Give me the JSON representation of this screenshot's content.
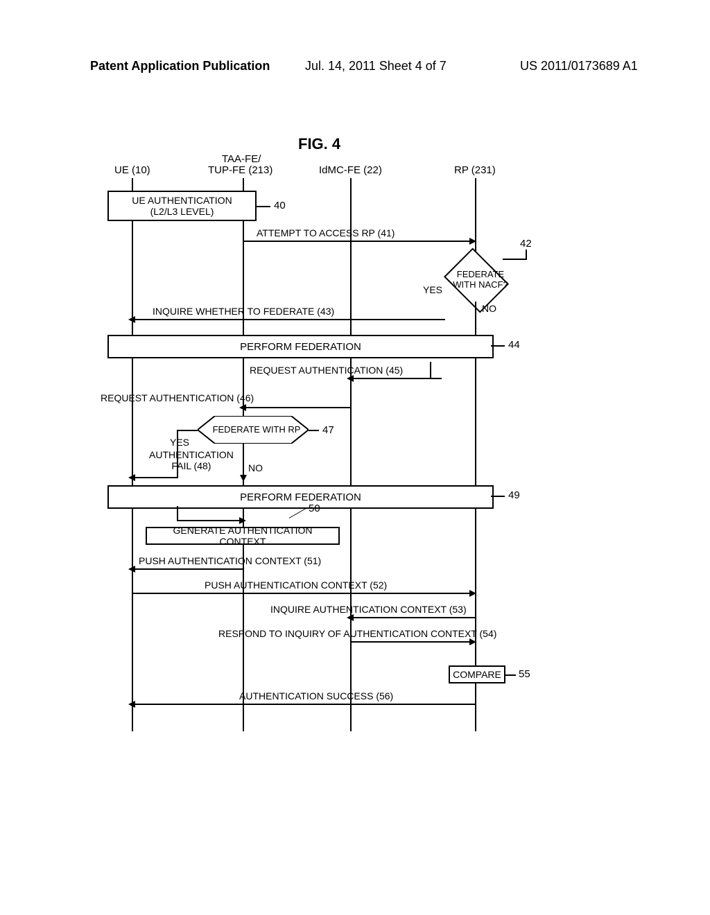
{
  "header": {
    "left": "Patent Application Publication",
    "center": "Jul. 14, 2011  Sheet 4 of 7",
    "right": "US 2011/0173689 A1"
  },
  "figure_title": "FIG.   4",
  "lanes": {
    "ue": "UE (10)",
    "taa_line1": "TAA-FE/",
    "taa_line2": "TUP-FE (213)",
    "idmc": "IdMC-FE (22)",
    "rp": "RP (231)"
  },
  "boxes": {
    "ue_auth_line1": "UE AUTHENTICATION",
    "ue_auth_line2": "(L2/L3 LEVEL)",
    "perform_fed_1": "PERFORM FEDERATION",
    "perform_fed_2": "PERFORM FEDERATION",
    "gen_auth_ctx": "GENERATE AUTHENTICATION CONTEXT",
    "compare": "COMPARE"
  },
  "diamonds": {
    "fed_nacf_line1": "FEDERATE",
    "fed_nacf_line2": "WITH NACF?",
    "fed_rp": "FEDERATE WITH RP"
  },
  "messages": {
    "m41": "ATTEMPT TO ACCESS RP (41)",
    "m43": "INQUIRE WHETHER TO FEDERATE  (43)",
    "m45": "REQUEST AUTHENTICATION (45)",
    "m46": "REQUEST AUTHENTICATION (46)",
    "m48_line1": "AUTHENTICATION",
    "m48_line2": "FAIL (48)",
    "m51": "PUSH AUTHENTICATION CONTEXT (51)",
    "m52": "PUSH AUTHENTICATION CONTEXT (52)",
    "m53": "INQUIRE AUTHENTICATION CONTEXT (53)",
    "m54": "RESPOND TO INQUIRY OF AUTHENTICATION CONTEXT (54)",
    "m56": "AUTHENTICATION SUCCESS (56)"
  },
  "labels": {
    "yes": "YES",
    "no": "NO"
  },
  "refs": {
    "r40": "40",
    "r42": "42",
    "r44": "44",
    "r47": "47",
    "r49": "49",
    "r50": "50",
    "r55": "55"
  },
  "chart_data": {
    "type": "sequence-diagram",
    "title": "FIG. 4",
    "participants": [
      {
        "id": "UE",
        "label": "UE (10)"
      },
      {
        "id": "TAA",
        "label": "TAA-FE/TUP-FE (213)"
      },
      {
        "id": "IdMC",
        "label": "IdMC-FE (22)"
      },
      {
        "id": "RP",
        "label": "RP (231)"
      }
    ],
    "steps": [
      {
        "ref": 40,
        "type": "process",
        "span": [
          "UE",
          "TAA"
        ],
        "text": "UE AUTHENTICATION (L2/L3 LEVEL)"
      },
      {
        "ref": 41,
        "type": "message",
        "from": "TAA",
        "to": "RP",
        "text": "ATTEMPT TO ACCESS RP"
      },
      {
        "ref": 42,
        "type": "decision",
        "at": "RP",
        "text": "FEDERATE WITH NACF?",
        "yes_to": 43,
        "no_to": 45
      },
      {
        "ref": 43,
        "type": "message",
        "from": "RP",
        "to": "UE",
        "text": "INQUIRE WHETHER TO FEDERATE"
      },
      {
        "ref": 44,
        "type": "process",
        "span": [
          "UE",
          "RP"
        ],
        "text": "PERFORM FEDERATION"
      },
      {
        "ref": 45,
        "type": "message",
        "from": "RP",
        "to": "IdMC",
        "text": "REQUEST AUTHENTICATION"
      },
      {
        "ref": 46,
        "type": "message",
        "from": "IdMC",
        "to": "TAA",
        "text": "REQUEST AUTHENTICATION"
      },
      {
        "ref": 47,
        "type": "decision",
        "at": "TAA",
        "text": "FEDERATE WITH RP",
        "yes_to": 48,
        "no_to": 49
      },
      {
        "ref": 48,
        "type": "message",
        "from": "TAA",
        "to": "UE",
        "text": "AUTHENTICATION FAIL"
      },
      {
        "ref": 49,
        "type": "process",
        "span": [
          "UE",
          "RP"
        ],
        "text": "PERFORM FEDERATION"
      },
      {
        "ref": 50,
        "type": "process",
        "span": [
          "UE",
          "TAA"
        ],
        "text": "GENERATE AUTHENTICATION CONTEXT"
      },
      {
        "ref": 51,
        "type": "message",
        "from": "TAA",
        "to": "UE",
        "text": "PUSH AUTHENTICATION CONTEXT"
      },
      {
        "ref": 52,
        "type": "message",
        "from": "UE",
        "to": "RP",
        "text": "PUSH AUTHENTICATION CONTEXT"
      },
      {
        "ref": 53,
        "type": "message",
        "from": "RP",
        "to": "IdMC",
        "text": "INQUIRE AUTHENTICATION CONTEXT"
      },
      {
        "ref": 54,
        "type": "message",
        "from": "IdMC",
        "to": "RP",
        "text": "RESPOND TO INQUIRY OF AUTHENTICATION CONTEXT"
      },
      {
        "ref": 55,
        "type": "process",
        "span": [
          "RP"
        ],
        "text": "COMPARE"
      },
      {
        "ref": 56,
        "type": "message",
        "from": "RP",
        "to": "UE",
        "text": "AUTHENTICATION SUCCESS"
      }
    ]
  }
}
